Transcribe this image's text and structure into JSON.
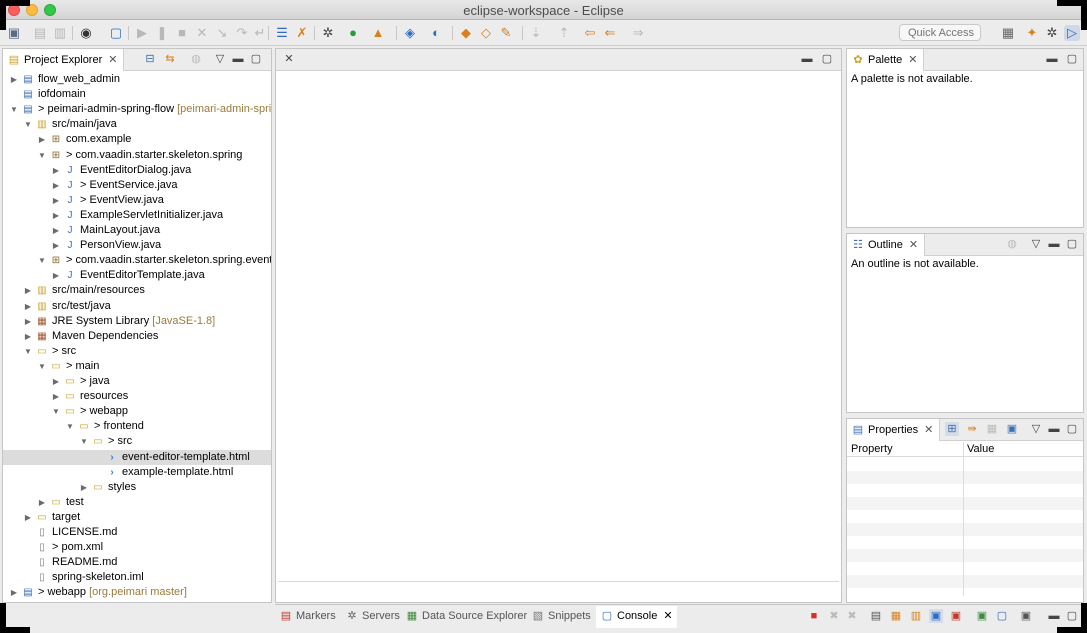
{
  "window": {
    "title": "eclipse-workspace - Eclipse"
  },
  "toolbar": {
    "quick_access_placeholder": "Quick Access"
  },
  "project_explorer": {
    "title": "Project Explorer",
    "tree": [
      {
        "label": "flow_web_admin",
        "deco": "",
        "depth": 0,
        "twisty": "collapsed",
        "icon": "project-icon"
      },
      {
        "label": "iofdomain",
        "deco": "",
        "depth": 0,
        "twisty": "none",
        "icon": "project-icon"
      },
      {
        "label": "> peimari-admin-spring-flow",
        "deco": " [peimari-admin-sprir",
        "depth": 0,
        "twisty": "expanded",
        "icon": "project-icon"
      },
      {
        "label": "src/main/java",
        "deco": "",
        "depth": 1,
        "twisty": "expanded",
        "icon": "source-folder-icon"
      },
      {
        "label": "com.example",
        "deco": "",
        "depth": 2,
        "twisty": "collapsed",
        "icon": "package-icon"
      },
      {
        "label": "> com.vaadin.starter.skeleton.spring",
        "deco": "",
        "depth": 2,
        "twisty": "expanded",
        "icon": "package-icon"
      },
      {
        "label": "EventEditorDialog.java",
        "deco": "",
        "depth": 3,
        "twisty": "collapsed",
        "icon": "java-file-icon"
      },
      {
        "label": "> EventService.java",
        "deco": "",
        "depth": 3,
        "twisty": "collapsed",
        "icon": "java-file-icon"
      },
      {
        "label": "> EventView.java",
        "deco": "",
        "depth": 3,
        "twisty": "collapsed",
        "icon": "java-file-icon"
      },
      {
        "label": "ExampleServletInitializer.java",
        "deco": "",
        "depth": 3,
        "twisty": "collapsed",
        "icon": "java-file-icon"
      },
      {
        "label": "MainLayout.java",
        "deco": "",
        "depth": 3,
        "twisty": "collapsed",
        "icon": "java-file-icon"
      },
      {
        "label": "PersonView.java",
        "deco": "",
        "depth": 3,
        "twisty": "collapsed",
        "icon": "java-file-icon"
      },
      {
        "label": "> com.vaadin.starter.skeleton.spring.evente",
        "deco": "",
        "depth": 2,
        "twisty": "expanded",
        "icon": "package-icon"
      },
      {
        "label": "EventEditorTemplate.java",
        "deco": "",
        "depth": 3,
        "twisty": "collapsed",
        "icon": "java-file-icon"
      },
      {
        "label": "src/main/resources",
        "deco": "",
        "depth": 1,
        "twisty": "collapsed",
        "icon": "source-folder-icon"
      },
      {
        "label": "src/test/java",
        "deco": "",
        "depth": 1,
        "twisty": "collapsed",
        "icon": "source-folder-icon"
      },
      {
        "label": "JRE System Library",
        "deco": " [JavaSE-1.8]",
        "depth": 1,
        "twisty": "collapsed",
        "icon": "library-icon"
      },
      {
        "label": "Maven Dependencies",
        "deco": "",
        "depth": 1,
        "twisty": "collapsed",
        "icon": "library-icon"
      },
      {
        "label": "> src",
        "deco": "",
        "depth": 1,
        "twisty": "expanded",
        "icon": "folder-icon"
      },
      {
        "label": "> main",
        "deco": "",
        "depth": 2,
        "twisty": "expanded",
        "icon": "folder-icon"
      },
      {
        "label": "> java",
        "deco": "",
        "depth": 3,
        "twisty": "collapsed",
        "icon": "folder-icon"
      },
      {
        "label": "resources",
        "deco": "",
        "depth": 3,
        "twisty": "collapsed",
        "icon": "folder-icon"
      },
      {
        "label": "> webapp",
        "deco": "",
        "depth": 3,
        "twisty": "expanded",
        "icon": "folder-icon"
      },
      {
        "label": "> frontend",
        "deco": "",
        "depth": 4,
        "twisty": "expanded",
        "icon": "folder-icon"
      },
      {
        "label": "> src",
        "deco": "",
        "depth": 5,
        "twisty": "expanded",
        "icon": "folder-icon"
      },
      {
        "label": "event-editor-template.html",
        "deco": "",
        "depth": 6,
        "twisty": "none",
        "icon": "html-file-icon",
        "selected": true
      },
      {
        "label": "example-template.html",
        "deco": "",
        "depth": 6,
        "twisty": "none",
        "icon": "html-file-icon"
      },
      {
        "label": "styles",
        "deco": "",
        "depth": 5,
        "twisty": "collapsed",
        "icon": "folder-icon"
      },
      {
        "label": "test",
        "deco": "",
        "depth": 2,
        "twisty": "collapsed",
        "icon": "folder-icon"
      },
      {
        "label": "target",
        "deco": "",
        "depth": 1,
        "twisty": "collapsed",
        "icon": "folder-icon"
      },
      {
        "label": "LICENSE.md",
        "deco": "",
        "depth": 1,
        "twisty": "none",
        "icon": "text-file-icon"
      },
      {
        "label": "> pom.xml",
        "deco": "",
        "depth": 1,
        "twisty": "none",
        "icon": "xml-file-icon"
      },
      {
        "label": "README.md",
        "deco": "",
        "depth": 1,
        "twisty": "none",
        "icon": "text-file-icon"
      },
      {
        "label": "spring-skeleton.iml",
        "deco": "",
        "depth": 1,
        "twisty": "none",
        "icon": "text-file-icon"
      },
      {
        "label": "> webapp",
        "deco": " [org.peimari master]",
        "depth": 0,
        "twisty": "collapsed",
        "icon": "project-icon"
      }
    ]
  },
  "palette": {
    "title": "Palette",
    "message": "A palette is not available."
  },
  "outline": {
    "title": "Outline",
    "message": "An outline is not available."
  },
  "properties": {
    "title": "Properties",
    "columns": [
      "Property",
      "Value"
    ]
  },
  "bottom_tabs": [
    {
      "label": "Markers",
      "icon": "markers-icon",
      "active": false
    },
    {
      "label": "Servers",
      "icon": "servers-icon",
      "active": false
    },
    {
      "label": "Data Source Explorer",
      "icon": "data-source-icon",
      "active": false
    },
    {
      "label": "Snippets",
      "icon": "snippets-icon",
      "active": false
    },
    {
      "label": "Console",
      "icon": "console-icon",
      "active": true
    }
  ]
}
